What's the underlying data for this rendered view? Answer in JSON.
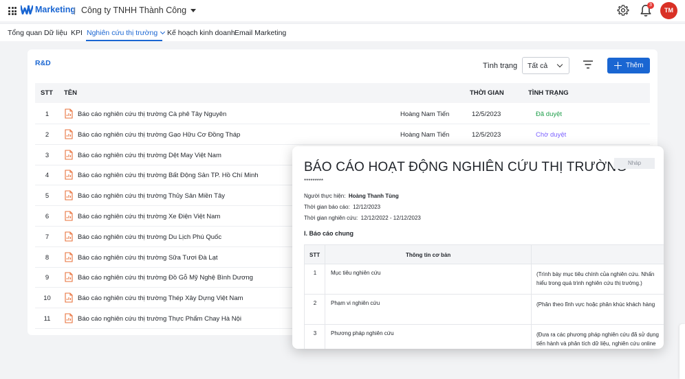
{
  "header": {
    "brand": "Marketing",
    "separator": "|",
    "company": "Công ty TNHH Thành Công",
    "notification_count": "3",
    "avatar_initials": "TM",
    "accent_color": "#1a66d2"
  },
  "nav": {
    "tabs": [
      {
        "label": "Tổng quan"
      },
      {
        "label": "Dữ liệu"
      },
      {
        "label": "KPI"
      },
      {
        "label": "Nghiên cứu thị trường"
      },
      {
        "label": "Kế hoạch kinh doanh"
      },
      {
        "label": "Email Marketing"
      }
    ],
    "active_tab": "Nghiên cứu thị trường"
  },
  "toolbar": {
    "section_title": "R&D",
    "status_label": "Tình trạng",
    "status_value": "Tất cả",
    "add_label": "Thêm"
  },
  "table": {
    "headers": {
      "stt": "STT",
      "name": "TÊN",
      "time": "THỜI GIAN",
      "status": "TÌNH TRẠNG"
    },
    "rows": [
      {
        "stt": "1",
        "name": "Báo cáo nghiên cứu thị trường Cà phê Tây Nguyên",
        "person": "Hoàng Nam Tiến",
        "date": "12/5/2023",
        "status": "Đã duyệt"
      },
      {
        "stt": "2",
        "name": "Báo cáo nghiên cứu thị trường Gạo Hữu Cơ Đồng Tháp",
        "person": "Hoàng Nam Tiến",
        "date": "12/5/2023",
        "status": "Chờ duyệt"
      },
      {
        "stt": "3",
        "name": "Báo cáo nghiên cứu thị trường Dệt May Việt Nam"
      },
      {
        "stt": "4",
        "name": "Báo cáo nghiên cứu thị trường Bất Động Sản TP. Hồ Chí Minh"
      },
      {
        "stt": "5",
        "name": "Báo cáo nghiên cứu thị trường Thủy Sản Miền Tây"
      },
      {
        "stt": "6",
        "name": "Báo cáo nghiên cứu thị trường Xe Điện Việt Nam"
      },
      {
        "stt": "7",
        "name": "Báo cáo nghiên cứu thị trường Du Lịch Phú Quốc"
      },
      {
        "stt": "8",
        "name": "Báo cáo nghiên cứu thị trường Sữa Tươi Đà Lạt"
      },
      {
        "stt": "9",
        "name": "Báo cáo nghiên cứu thị trường Đồ Gỗ Mỹ Nghệ Bình Dương"
      },
      {
        "stt": "10",
        "name": "Báo cáo nghiên cứu thị trường Thép Xây Dựng Việt Nam"
      },
      {
        "stt": "11",
        "name": "Báo cáo nghiên cứu thị trường Thực Phẩm Chay Hà Nội"
      }
    ]
  },
  "document": {
    "title": "BÁO CÁO HOẠT ĐỘNG NGHIÊN CỨU THỊ TRƯỜNG",
    "badge": "Nháp",
    "stars": "*********",
    "performer_label": "Người thực hiện:",
    "performer": "Hoàng Thanh Tùng",
    "report_time_label": "Thời gian báo cáo:",
    "report_time": "12/12/2023",
    "research_time_label": "Thời gian nghiên cứu:",
    "research_time": "12/12/2022 - 12/12/2023",
    "section": "I. Báo cáo chung",
    "table_headers": {
      "stt": "STT",
      "info": "Thông tin cơ bản"
    },
    "rows": [
      {
        "stt": "1",
        "info": "Mục tiêu nghiên cứu",
        "desc1": "(Trình bày mục tiêu chính của nghiên cứu. Nhấn",
        "desc2": "hiểu trong quá trình nghiên cứu thị trường.)"
      },
      {
        "stt": "2",
        "info": "Phạm vi nghiên cứu",
        "desc1": " (Phân theo lĩnh vực hoặc phân khúc khách hàng",
        "desc2": ""
      },
      {
        "stt": "3",
        "info": "Phương pháp nghiên cứu",
        "desc1": "(Đưa ra các phương pháp nghiên cứu đã sử dụng",
        "desc2": "tiến hành và phân tích dữ liệu, nghiên cứu online"
      }
    ]
  }
}
